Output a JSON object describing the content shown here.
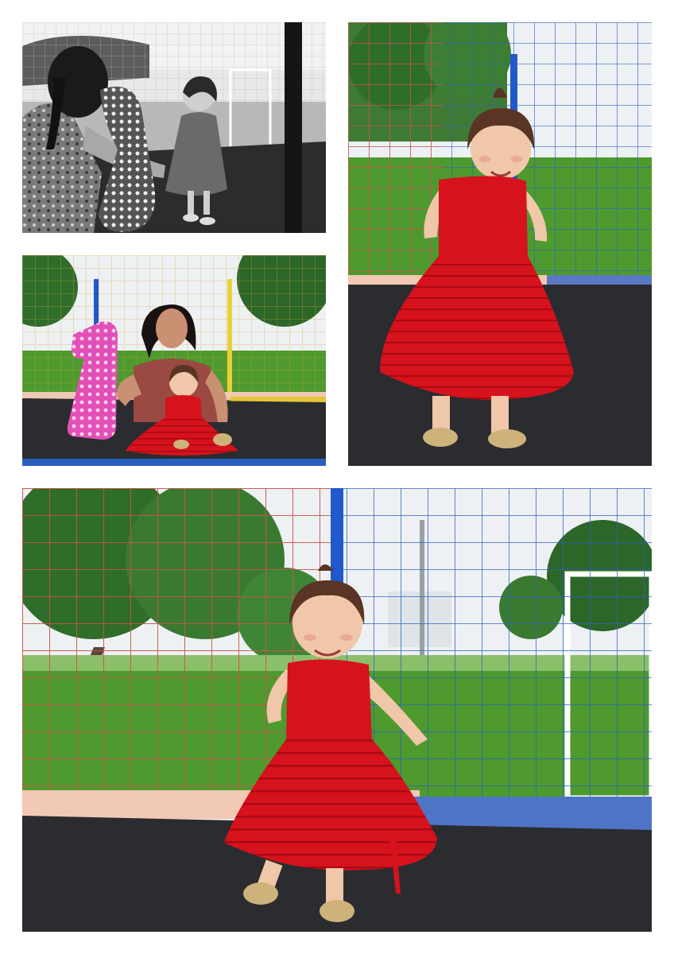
{
  "collage": {
    "background": "#ffffff",
    "photos": [
      {
        "id": "photo-mother-daughter-bw",
        "style": "grayscale"
      },
      {
        "id": "photo-girl-standing-red-dress",
        "style": "color"
      },
      {
        "id": "photo-mother-daughter-balloon",
        "style": "color"
      },
      {
        "id": "photo-girl-walking-trampoline",
        "style": "color"
      }
    ],
    "balloon_text": "1",
    "colors": {
      "dress_red": "#d6121c",
      "grass_green": "#4e9a2e",
      "trampoline_black": "#2b2c30",
      "net_blue": "#2a62c4",
      "net_orange": "#e9542c",
      "balloon_pink": "#e24fb7",
      "shoe_gold": "#cdb27a"
    }
  }
}
